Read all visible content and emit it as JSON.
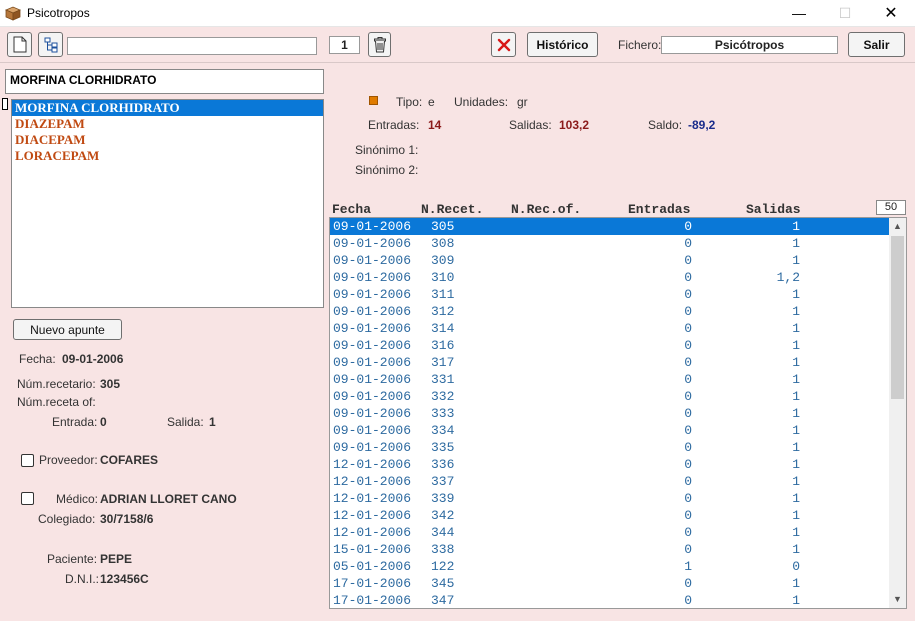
{
  "window": {
    "title": "Psicotropos",
    "minimize": "—",
    "maximize": "☐",
    "close": "✕"
  },
  "toolbar": {
    "new_icon": "document-icon",
    "tree_icon": "tree-icon",
    "search_value": "",
    "page_number": "1",
    "delete_icon": "trash-icon",
    "cancel_icon": "red-x-icon",
    "historico_label": "Histórico",
    "fichero_label": "Fichero:",
    "fichero_value": "Psicótropos",
    "salir_label": "Salir"
  },
  "left": {
    "selected_name": "MORFINA CLORHIDRATO",
    "items": [
      {
        "label": "MORFINA CLORHIDRATO"
      },
      {
        "label": "DIAZEPAM"
      },
      {
        "label": "DIACEPAM"
      },
      {
        "label": "LORACEPAM"
      }
    ],
    "nuevo_apunte": "Nuevo apunte",
    "fecha_label": "Fecha:",
    "fecha_value": "09-01-2006",
    "num_recetario_label": "Núm.recetario:",
    "num_recetario_value": "305",
    "num_receta_of_label": "Núm.receta of:",
    "num_receta_of_value": "",
    "entrada_label": "Entrada:",
    "entrada_value": "0",
    "salida_label": "Salida:",
    "salida_value": "1",
    "proveedor_label": "Proveedor:",
    "proveedor_value": "COFARES",
    "medico_label": "Médico:",
    "medico_value": "ADRIAN LLORET CANO",
    "colegiado_label": "Colegiado:",
    "colegiado_value": "30/7158/6",
    "paciente_label": "Paciente:",
    "paciente_value": "PEPE",
    "dni_label": "D.N.I.:",
    "dni_value": "123456C"
  },
  "info": {
    "tipo_label": "Tipo:",
    "tipo_value": "e",
    "unidades_label": "Unidades:",
    "unidades_value": "gr",
    "entradas_label": "Entradas:",
    "entradas_value": "14",
    "salidas_label": "Salidas:",
    "salidas_value": "103,2",
    "saldo_label": "Saldo:",
    "saldo_value": "-89,2",
    "sinonimo1_label": "Sinónimo 1:",
    "sinonimo2_label": "Sinónimo 2:",
    "colors": {
      "entradas": "#8b1a1a",
      "salidas": "#8b1a1a",
      "saldo": "#1a2c8b",
      "tipo_marker": "#e07b00"
    }
  },
  "grid": {
    "headers": [
      "Fecha",
      "N.Recet.",
      "N.Rec.of.",
      "Entradas",
      "Salidas"
    ],
    "count": "50",
    "rows": [
      [
        "09-01-2006",
        "305",
        "",
        "0",
        "1"
      ],
      [
        "09-01-2006",
        "308",
        "",
        "0",
        "1"
      ],
      [
        "09-01-2006",
        "309",
        "",
        "0",
        "1"
      ],
      [
        "09-01-2006",
        "310",
        "",
        "0",
        "1,2"
      ],
      [
        "09-01-2006",
        "311",
        "",
        "0",
        "1"
      ],
      [
        "09-01-2006",
        "312",
        "",
        "0",
        "1"
      ],
      [
        "09-01-2006",
        "314",
        "",
        "0",
        "1"
      ],
      [
        "09-01-2006",
        "316",
        "",
        "0",
        "1"
      ],
      [
        "09-01-2006",
        "317",
        "",
        "0",
        "1"
      ],
      [
        "09-01-2006",
        "331",
        "",
        "0",
        "1"
      ],
      [
        "09-01-2006",
        "332",
        "",
        "0",
        "1"
      ],
      [
        "09-01-2006",
        "333",
        "",
        "0",
        "1"
      ],
      [
        "09-01-2006",
        "334",
        "",
        "0",
        "1"
      ],
      [
        "09-01-2006",
        "335",
        "",
        "0",
        "1"
      ],
      [
        "12-01-2006",
        "336",
        "",
        "0",
        "1"
      ],
      [
        "12-01-2006",
        "337",
        "",
        "0",
        "1"
      ],
      [
        "12-01-2006",
        "339",
        "",
        "0",
        "1"
      ],
      [
        "12-01-2006",
        "342",
        "",
        "0",
        "1"
      ],
      [
        "12-01-2006",
        "344",
        "",
        "0",
        "1"
      ],
      [
        "15-01-2006",
        "338",
        "",
        "0",
        "1"
      ],
      [
        "05-01-2006",
        "122",
        "",
        "1",
        "0"
      ],
      [
        "17-01-2006",
        "345",
        "",
        "0",
        "1"
      ],
      [
        "17-01-2006",
        "347",
        "",
        "0",
        "1"
      ]
    ]
  }
}
